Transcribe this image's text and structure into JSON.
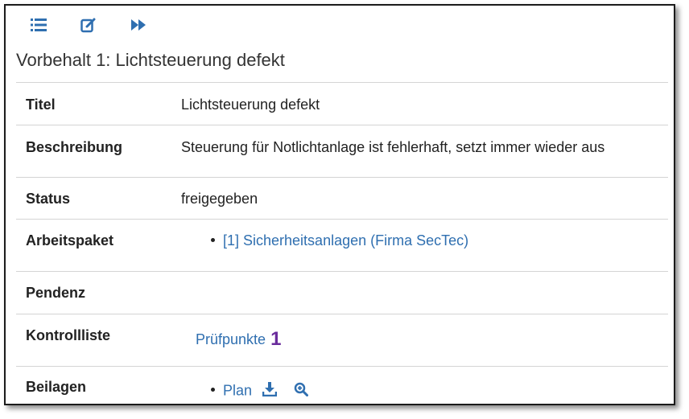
{
  "toolbar": {
    "icons": [
      "list-icon",
      "edit-icon",
      "fast-forward-icon"
    ],
    "color": "#2f6fb0"
  },
  "page_title": "Vorbehalt 1: Lichtsteuerung defekt",
  "rows": {
    "titel": {
      "label": "Titel",
      "value": "Lichtsteuerung defekt"
    },
    "beschreibung": {
      "label": "Beschreibung",
      "value": "Steuerung für Notlichtanlage ist fehlerhaft, setzt immer wieder aus"
    },
    "status": {
      "label": "Status",
      "value": "freigegeben"
    },
    "arbeitspaket": {
      "label": "Arbeitspaket",
      "link": "[1] Sicherheitsanlagen (Firma SecTec)"
    },
    "pendenz": {
      "label": "Pendenz"
    },
    "kontrollliste": {
      "label": "Kontrollliste",
      "link": "Prüfpunkte",
      "count": "1"
    },
    "beilagen": {
      "label": "Beilagen",
      "link": "Plan",
      "icons": [
        "download-icon",
        "zoom-in-icon"
      ]
    }
  },
  "colors": {
    "link": "#2f6fb0",
    "count": "#6a2c9c",
    "divider": "#d4d4d4"
  }
}
